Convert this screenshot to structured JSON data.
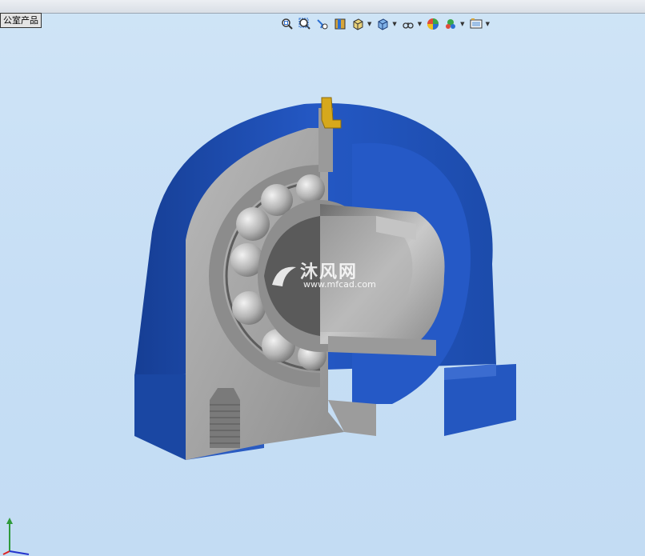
{
  "tab": {
    "label": "公室产品"
  },
  "toolbar": {
    "icons": [
      "zoom-to-fit-icon",
      "zoom-area-icon",
      "previous-view-icon",
      "section-view-icon",
      "view-orientation-icon",
      "display-style-icon",
      "hide-show-icon",
      "edit-appearance-icon",
      "apply-scene-icon",
      "view-settings-icon"
    ]
  },
  "watermark": {
    "brand": "沐风网",
    "url": "www.mfcad.com"
  },
  "colors": {
    "housing_blue": "#1f4fb0",
    "section_gray": "#a4a4a4",
    "background": "#c6def5",
    "grease_fitting": "#d6a81c"
  }
}
